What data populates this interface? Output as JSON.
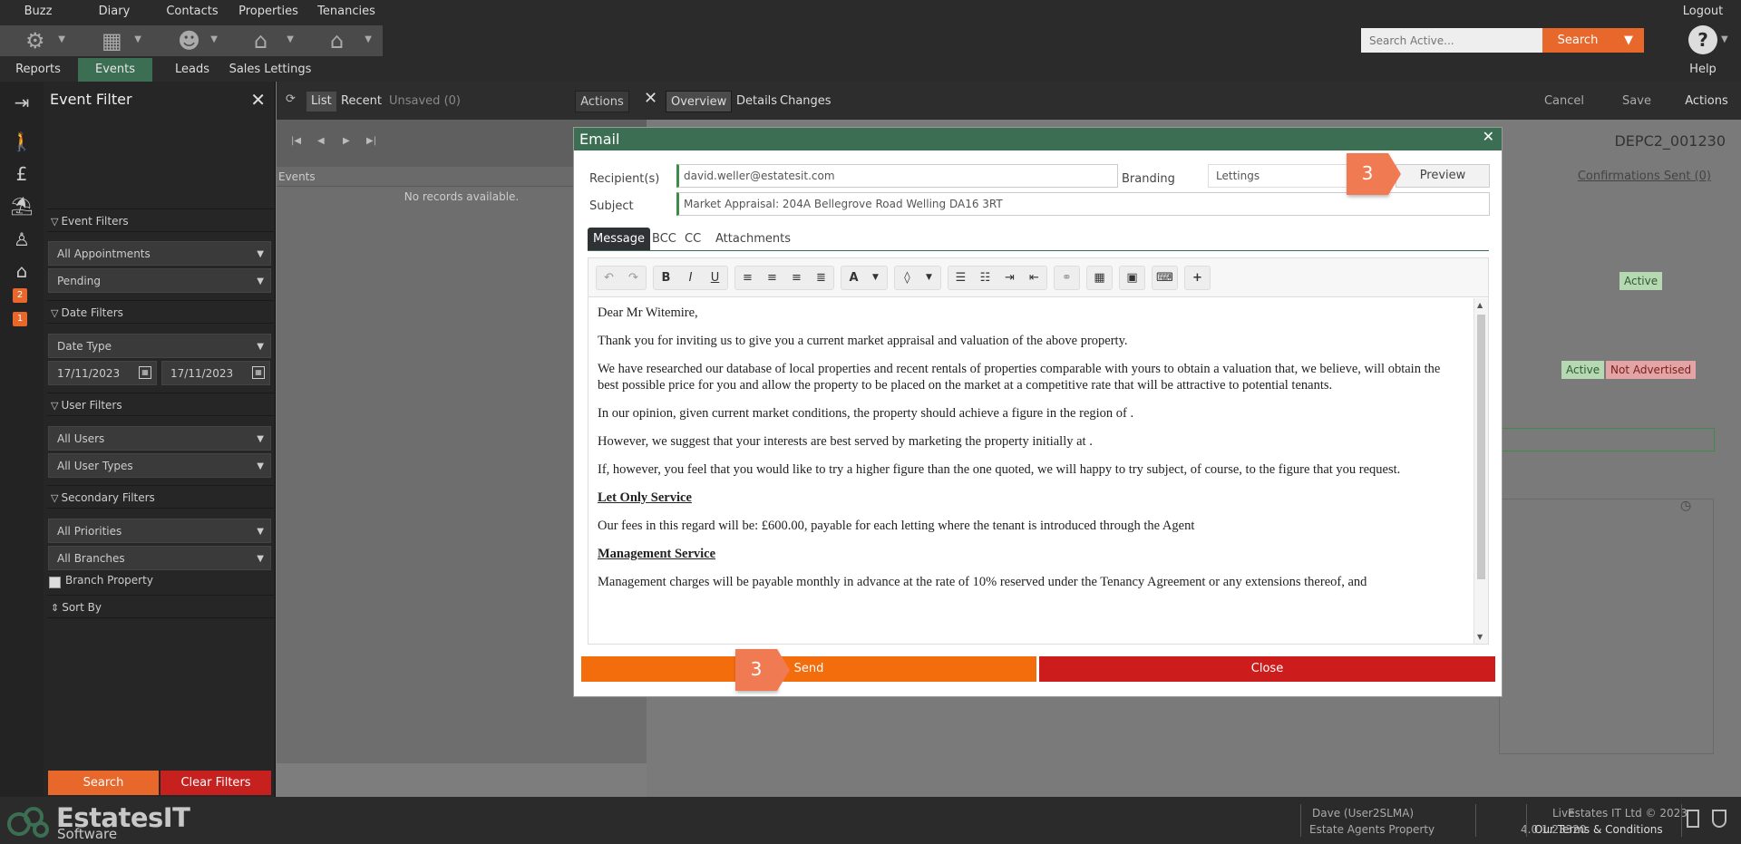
{
  "topnav": {
    "items": [
      "Buzz",
      "Diary",
      "Contacts",
      "Properties",
      "Tenancies"
    ],
    "bottom": [
      "Reports",
      "Events",
      "Leads",
      "Sales Lettings"
    ],
    "logout": "Logout",
    "help": "Help",
    "search_placeholder": "Search Active...",
    "search_label": "Search"
  },
  "rail": {
    "badge1": "2",
    "badge2": "1"
  },
  "event_filter": {
    "title": "Event Filter",
    "sections": {
      "event": "Event Filters",
      "date": "Date Filters",
      "user": "User Filters",
      "secondary": "Secondary Filters",
      "sort": "Sort By"
    },
    "selects": {
      "appointments": "All Appointments",
      "status": "Pending",
      "date_type": "Date Type",
      "users": "All Users",
      "user_types": "All User Types",
      "priorities": "All Priorities",
      "branches": "All Branches"
    },
    "date_from": "17/11/2023",
    "date_to": "17/11/2023",
    "branch_property": "Branch Property",
    "search": "Search",
    "clear": "Clear Filters"
  },
  "list": {
    "tabs": [
      "List",
      "Recent",
      "Unsaved (0)"
    ],
    "header": "Events",
    "empty": "No records available."
  },
  "detail": {
    "actions_left": "Actions",
    "tabs": [
      "Overview",
      "Details",
      "Changes"
    ],
    "buttons": [
      "Cancel",
      "Save",
      "Actions"
    ],
    "ref": "DEPC2_001230",
    "confirmations": "Confirmations Sent (0)",
    "badges": [
      "Active",
      "Active",
      "Not Advertised"
    ]
  },
  "modal": {
    "title": "Email",
    "recipients_label": "Recipient(s)",
    "recipients": "david.weller@estatesit.com",
    "subject_label": "Subject",
    "subject": "Market Appraisal: 204A Bellegrove Road Welling DA16 3RT",
    "branding_label": "Branding",
    "branding": "Lettings",
    "preview": "Preview",
    "step": "3",
    "tabs": [
      "Message",
      "BCC",
      "CC",
      "Attachments"
    ],
    "body": {
      "greeting": "Dear Mr Witemire,",
      "p1": "Thank you for inviting us to give you a current market appraisal and valuation of the above property.",
      "p2": "We have researched our database of local properties and recent rentals of properties comparable with yours to obtain a valuation that, we believe, will obtain the best possible price for you and allow the property to be placed on the market at a competitive rate that will be attractive to potential tenants.",
      "p3": "In our opinion, given current market conditions, the property should achieve a figure in the region of .",
      "p4": "However, we suggest that your interests are best served by marketing the property initially at .",
      "p5": "If, however, you feel that you would like to try a higher figure than the one quoted, we will happy to try subject, of course, to the figure that you request.",
      "h1": "Let Only Service",
      "p6": "Our fees in this regard will be: £600.00, payable for each letting where the tenant is introduced through the Agent",
      "h2": "Management Service",
      "p7": "Management charges will be payable monthly in advance at the rate of 10% reserved under the Tenancy Agreement or any extensions thereof, and"
    },
    "send": "Send",
    "close": "Close"
  },
  "footer": {
    "logo": "EstatesIT",
    "logo_sub": "Software",
    "user": "Dave (User2SLMA)",
    "company": "Estate Agents Property",
    "env": "Live",
    "version": "4.0.1.23320",
    "copyright": "Estates IT Ltd © 2023",
    "terms": "Our Terms & Conditions"
  },
  "colors": {
    "brand_green": "#3c6e53",
    "accent_orange": "#e8672b",
    "danger_red": "#cd1c1c",
    "step_orange": "#f07b52"
  }
}
